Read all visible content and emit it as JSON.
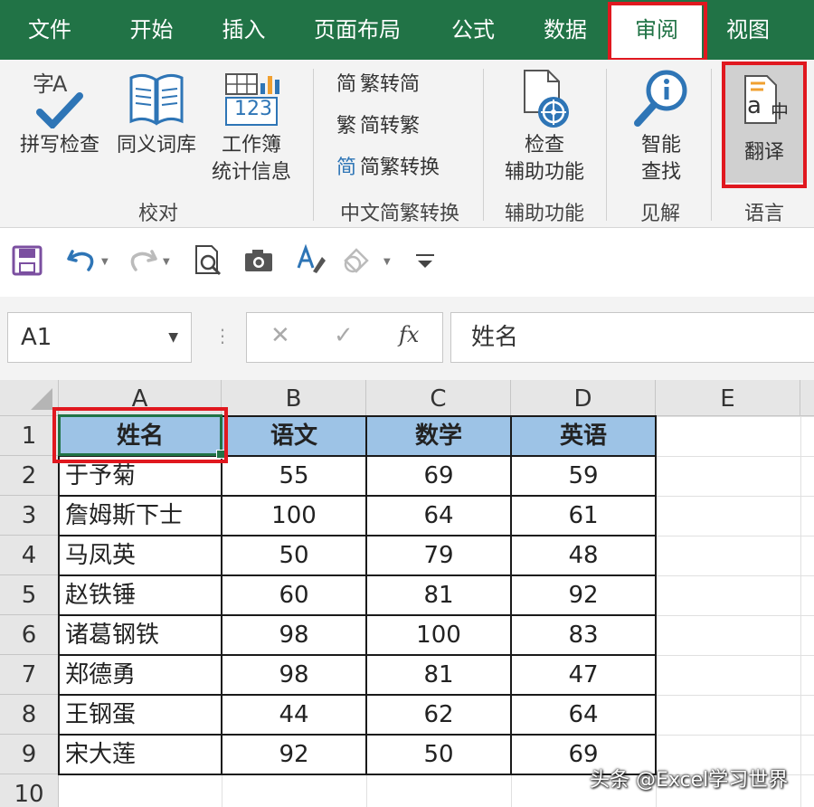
{
  "tabs": [
    {
      "label": "文件"
    },
    {
      "label": "开始"
    },
    {
      "label": "插入"
    },
    {
      "label": "页面布局"
    },
    {
      "label": "公式"
    },
    {
      "label": "数据"
    },
    {
      "label": "审阅"
    },
    {
      "label": "视图"
    }
  ],
  "active_tab": "审阅",
  "ribbon": {
    "proofing": {
      "spelling": "拼写检查",
      "thesaurus": "同义词库",
      "workbook_stats_line1": "工作簿",
      "workbook_stats_line2": "统计信息",
      "group_label": "校对",
      "icon_text_zi": "字A",
      "icon_text_123": "123"
    },
    "chinese_conversion": {
      "trad_to_simp": "繁转简",
      "simp_to_trad": "简转繁",
      "convert": "简繁转换",
      "group_label": "中文简繁转换",
      "icon_jian": "简",
      "icon_fan": "繁",
      "icon_mixed": "简"
    },
    "accessibility": {
      "check_line1": "检查",
      "check_line2": "辅助功能",
      "group_label": "辅助功能"
    },
    "insights": {
      "smart_lookup_line1": "智能",
      "smart_lookup_line2": "查找",
      "group_label": "见解"
    },
    "language": {
      "translate": "翻译",
      "group_label": "语言",
      "icon_a": "a",
      "icon_zh": "中"
    }
  },
  "formula_bar": {
    "name_box": "A1",
    "formula": "姓名",
    "cancel_symbol": "✕",
    "enter_symbol": "✓",
    "fx_symbol": "fx"
  },
  "grid": {
    "columns": [
      "A",
      "B",
      "C",
      "D",
      "E"
    ],
    "rows": [
      "1",
      "2",
      "3",
      "4",
      "5",
      "6",
      "7",
      "8",
      "9",
      "10"
    ],
    "header_row": [
      "姓名",
      "语文",
      "数学",
      "英语"
    ],
    "data": [
      [
        "于予菊",
        "55",
        "69",
        "59"
      ],
      [
        "詹姆斯下士",
        "100",
        "64",
        "61"
      ],
      [
        "马凤英",
        "50",
        "79",
        "48"
      ],
      [
        "赵铁锤",
        "60",
        "81",
        "92"
      ],
      [
        "诸葛钢铁",
        "98",
        "100",
        "83"
      ],
      [
        "郑德勇",
        "98",
        "81",
        "47"
      ],
      [
        "王钢蛋",
        "44",
        "62",
        "64"
      ],
      [
        "宋大莲",
        "92",
        "50",
        "69"
      ]
    ],
    "header_fill": "#9dc3e6",
    "selected_cell": "A1"
  },
  "watermark": "头条 @Excel学习世界",
  "colors": {
    "excel_green": "#217346",
    "highlight_red": "#e0181f",
    "accent_blue": "#2e75b6"
  }
}
